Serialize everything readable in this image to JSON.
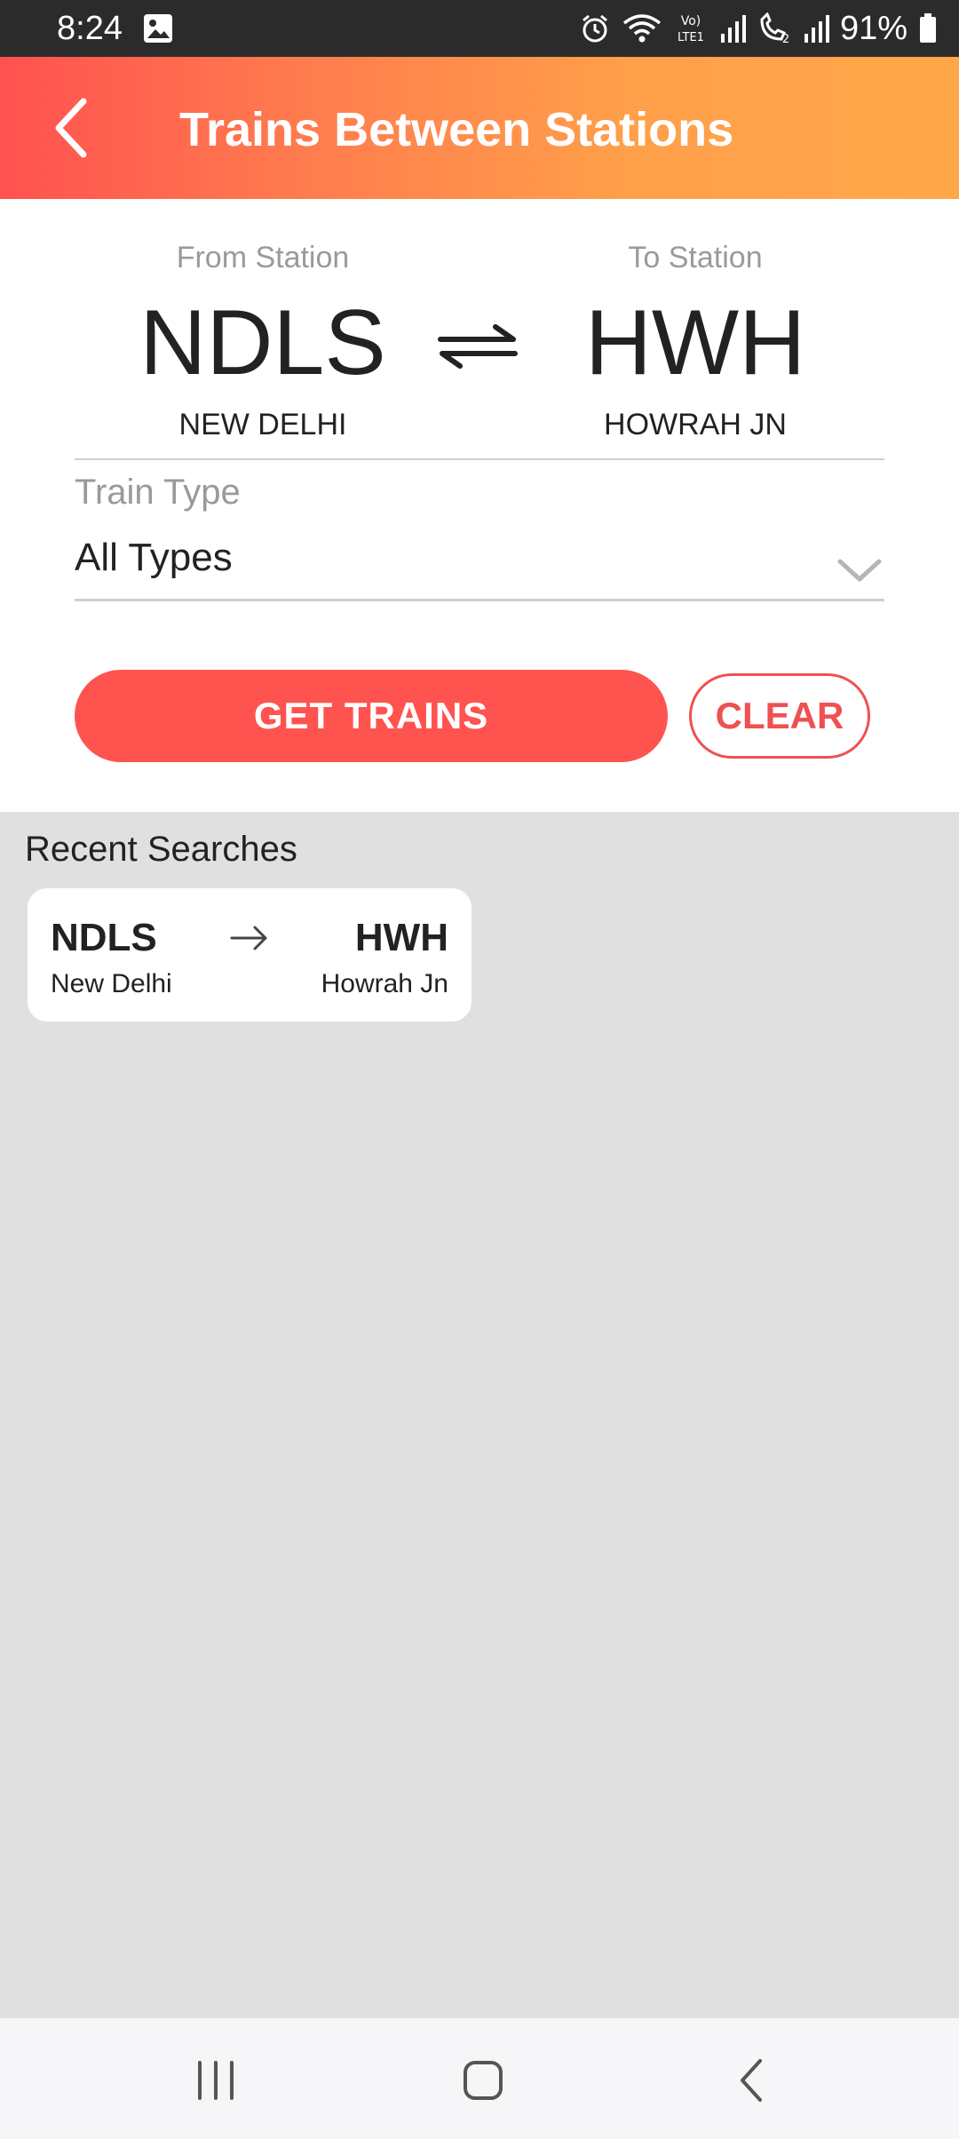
{
  "status_bar": {
    "time": "8:24",
    "battery": "91%",
    "icons": [
      "gallery-icon",
      "alarm-icon",
      "wifi-icon",
      "volte-icon",
      "signal-icon",
      "call-icon",
      "signal-2-icon",
      "battery-icon"
    ]
  },
  "header": {
    "title": "Trains Between Stations",
    "back_icon": "back-arrow-icon",
    "gradient_colors": [
      "#ff5150",
      "#ffa84a"
    ]
  },
  "form": {
    "from": {
      "label": "From Station",
      "code": "NDLS",
      "name": "NEW DELHI"
    },
    "to": {
      "label": "To Station",
      "code": "HWH",
      "name": "HOWRAH JN"
    },
    "swap_icon": "swap-icon",
    "train_type": {
      "label": "Train Type",
      "value": "All Types"
    },
    "get_trains_label": "GET TRAINS",
    "clear_label": "CLEAR",
    "accent_color": "#ff5350"
  },
  "recent": {
    "title": "Recent Searches",
    "items": [
      {
        "from_code": "NDLS",
        "from_name": "New Delhi",
        "to_code": "HWH",
        "to_name": "Howrah Jn"
      }
    ]
  },
  "navbar": {
    "buttons": [
      "recent-apps-icon",
      "home-icon",
      "back-icon"
    ]
  }
}
